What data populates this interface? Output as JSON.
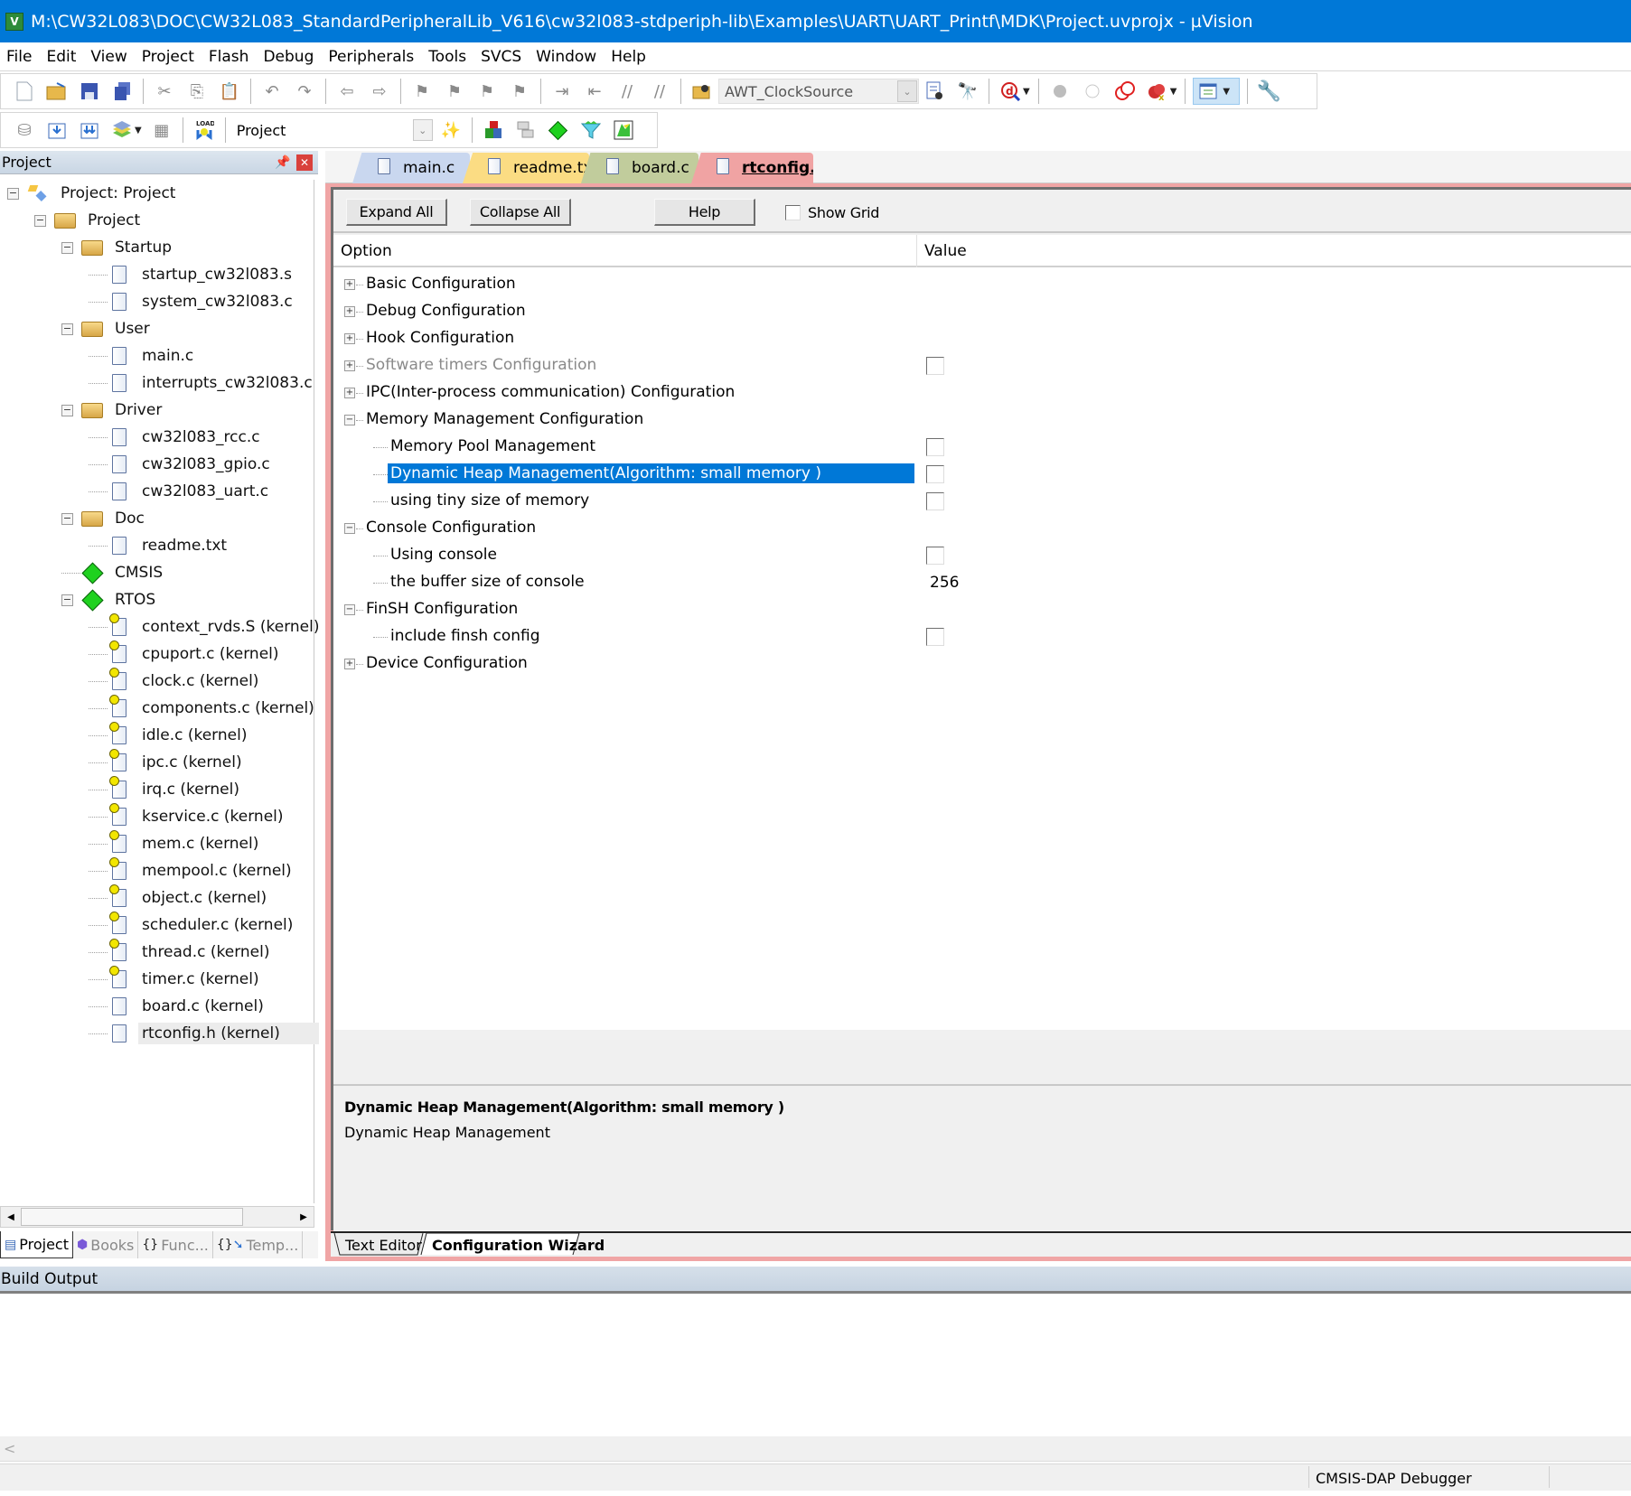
{
  "window": {
    "title": "M:\\CW32L083\\DOC\\CW32L083_StandardPeripheralLib_V616\\cw32l083-stdperiph-lib\\Examples\\UART\\UART_Printf\\MDK\\Project.uvprojx - µVision"
  },
  "menu": [
    "File",
    "Edit",
    "View",
    "Project",
    "Flash",
    "Debug",
    "Peripherals",
    "Tools",
    "SVCS",
    "Window",
    "Help"
  ],
  "toolbar1": {
    "find_combo_value": "AWT_ClockSource"
  },
  "toolbar2": {
    "target_combo_value": "Project"
  },
  "project_panel": {
    "title": "Project",
    "tree": [
      {
        "label": "Project: Project",
        "level": 0,
        "type": "root",
        "expanded": true
      },
      {
        "label": "Project",
        "level": 1,
        "type": "target",
        "expanded": true
      },
      {
        "label": "Startup",
        "level": 2,
        "type": "folder",
        "expanded": true
      },
      {
        "label": "startup_cw32l083.s",
        "level": 3,
        "type": "file"
      },
      {
        "label": "system_cw32l083.c",
        "level": 3,
        "type": "file"
      },
      {
        "label": "User",
        "level": 2,
        "type": "folder",
        "expanded": true
      },
      {
        "label": "main.c",
        "level": 3,
        "type": "file"
      },
      {
        "label": "interrupts_cw32l083.c",
        "level": 3,
        "type": "file"
      },
      {
        "label": "Driver",
        "level": 2,
        "type": "folder",
        "expanded": true
      },
      {
        "label": "cw32l083_rcc.c",
        "level": 3,
        "type": "file"
      },
      {
        "label": "cw32l083_gpio.c",
        "level": 3,
        "type": "file"
      },
      {
        "label": "cw32l083_uart.c",
        "level": 3,
        "type": "file"
      },
      {
        "label": "Doc",
        "level": 2,
        "type": "folder",
        "expanded": true
      },
      {
        "label": "readme.txt",
        "level": 3,
        "type": "file"
      },
      {
        "label": "CMSIS",
        "level": 2,
        "type": "component"
      },
      {
        "label": "RTOS",
        "level": 2,
        "type": "component",
        "expanded": true
      },
      {
        "label": "context_rvds.S (kernel)",
        "level": 3,
        "type": "locked-file"
      },
      {
        "label": "cpuport.c (kernel)",
        "level": 3,
        "type": "locked-file"
      },
      {
        "label": "clock.c (kernel)",
        "level": 3,
        "type": "locked-file"
      },
      {
        "label": "components.c (kernel)",
        "level": 3,
        "type": "locked-file"
      },
      {
        "label": "idle.c (kernel)",
        "level": 3,
        "type": "locked-file"
      },
      {
        "label": "ipc.c (kernel)",
        "level": 3,
        "type": "locked-file"
      },
      {
        "label": "irq.c (kernel)",
        "level": 3,
        "type": "locked-file"
      },
      {
        "label": "kservice.c (kernel)",
        "level": 3,
        "type": "locked-file"
      },
      {
        "label": "mem.c (kernel)",
        "level": 3,
        "type": "locked-file"
      },
      {
        "label": "mempool.c (kernel)",
        "level": 3,
        "type": "locked-file"
      },
      {
        "label": "object.c (kernel)",
        "level": 3,
        "type": "locked-file"
      },
      {
        "label": "scheduler.c (kernel)",
        "level": 3,
        "type": "locked-file"
      },
      {
        "label": "thread.c (kernel)",
        "level": 3,
        "type": "locked-file"
      },
      {
        "label": "timer.c (kernel)",
        "level": 3,
        "type": "locked-file"
      },
      {
        "label": "board.c (kernel)",
        "level": 3,
        "type": "file"
      },
      {
        "label": "rtconfig.h (kernel)",
        "level": 3,
        "type": "file",
        "selected": true
      }
    ],
    "tabs": [
      {
        "label": "Project",
        "active": true
      },
      {
        "label": "Books"
      },
      {
        "label": "Func..."
      },
      {
        "label": "Temp..."
      }
    ]
  },
  "editor": {
    "tabs": [
      {
        "label": "main.c",
        "color": "#c9d7ef"
      },
      {
        "label": "readme.txt",
        "color": "#fbdc83"
      },
      {
        "label": "board.c",
        "color": "#c1cc9c"
      },
      {
        "label": "rtconfig.h",
        "color": "#f0a3a3",
        "active": true
      }
    ],
    "wizard": {
      "expand_all": "Expand All",
      "collapse_all": "Collapse All",
      "help": "Help",
      "show_grid": "Show Grid",
      "show_grid_checked": false,
      "col_option": "Option",
      "col_value": "Value",
      "options": [
        {
          "label": "Basic Configuration",
          "level": 0,
          "expandable": "plus"
        },
        {
          "label": "Debug Configuration",
          "level": 0,
          "expandable": "plus"
        },
        {
          "label": "Hook Configuration",
          "level": 0,
          "expandable": "plus"
        },
        {
          "label": "Software timers Configuration",
          "level": 0,
          "expandable": "plus",
          "disabled": true,
          "checkbox": false
        },
        {
          "label": "IPC(Inter-process communication) Configuration",
          "level": 0,
          "expandable": "plus"
        },
        {
          "label": "Memory Management Configuration",
          "level": 0,
          "expandable": "minus"
        },
        {
          "label": "Memory Pool Management",
          "level": 1,
          "checkbox": false
        },
        {
          "label": "Dynamic Heap Management(Algorithm: small memory )",
          "level": 1,
          "checkbox": false,
          "selected": true
        },
        {
          "label": "using tiny size of memory",
          "level": 1,
          "checkbox": false
        },
        {
          "label": "Console Configuration",
          "level": 0,
          "expandable": "minus"
        },
        {
          "label": "Using console",
          "level": 1,
          "checkbox": false
        },
        {
          "label": "the buffer size of console",
          "level": 1,
          "value": "256"
        },
        {
          "label": "FinSH Configuration",
          "level": 0,
          "expandable": "minus"
        },
        {
          "label": "include finsh config",
          "level": 1,
          "checkbox": false
        },
        {
          "label": "Device Configuration",
          "level": 0,
          "expandable": "plus"
        }
      ],
      "description_title": "Dynamic Heap Management(Algorithm: small memory )",
      "description_text": "Dynamic Heap Management"
    },
    "bottom_tabs": [
      {
        "label": "Text Editor"
      },
      {
        "label": "Configuration Wizard",
        "active": true
      }
    ]
  },
  "build_output": {
    "title": "Build Output",
    "scroll_left": "<"
  },
  "status_bar": {
    "debugger": "CMSIS-DAP Debugger"
  },
  "colors": {
    "titlebar": "#0078d7",
    "selection": "#0078d7",
    "active_doc_frame": "#f0a5a5"
  }
}
